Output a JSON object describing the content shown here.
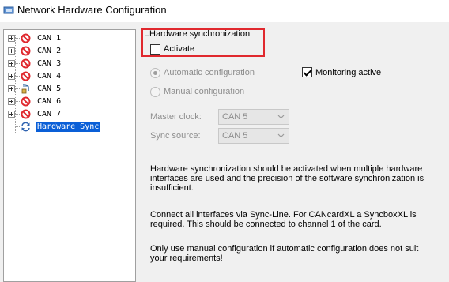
{
  "window": {
    "title": "Network Hardware Configuration",
    "icon": "network-app-icon"
  },
  "tree": {
    "items": [
      {
        "label": "CAN 1",
        "icon": "disabled-icon",
        "status_color": "#e0282e"
      },
      {
        "label": "CAN 2",
        "icon": "disabled-icon",
        "status_color": "#e0282e"
      },
      {
        "label": "CAN 3",
        "icon": "disabled-icon",
        "status_color": "#e0282e"
      },
      {
        "label": "CAN 4",
        "icon": "disabled-icon",
        "status_color": "#e0282e"
      },
      {
        "label": "CAN 5",
        "icon": "connector-icon",
        "status_color": "#3a6ea5"
      },
      {
        "label": "CAN 6",
        "icon": "disabled-icon",
        "status_color": "#e0282e"
      },
      {
        "label": "CAN 7",
        "icon": "disabled-icon",
        "status_color": "#e0282e"
      }
    ],
    "sync_item": {
      "label": "Hardware Sync",
      "icon": "sync-icon",
      "selected": true
    }
  },
  "hw_sync": {
    "group_label": "Hardware synchronization",
    "activate_label": "Activate",
    "activate_checked": false,
    "auto_config_label": "Automatic configuration",
    "auto_config_selected": true,
    "manual_config_label": "Manual configuration",
    "manual_config_selected": false,
    "monitoring_label": "Monitoring active",
    "monitoring_checked": true,
    "master_clock_label": "Master clock:",
    "master_clock_value": "CAN 5",
    "sync_source_label": "Sync source:",
    "sync_source_value": "CAN 5",
    "desc1": "Hardware synchronization should be activated when multiple hardware interfaces are used and the precision of the software synchronization is insufficient.",
    "desc2": "Connect all interfaces via Sync-Line. For CANcardXL a SyncboxXL is required. This should be connected to channel 1 of the card.",
    "desc3": "Only use manual configuration if automatic configuration does not suit your requirements!"
  },
  "colors": {
    "highlight": "#e0282e",
    "selection": "#0a5fd7",
    "disabled_text": "#8d8d8d"
  }
}
